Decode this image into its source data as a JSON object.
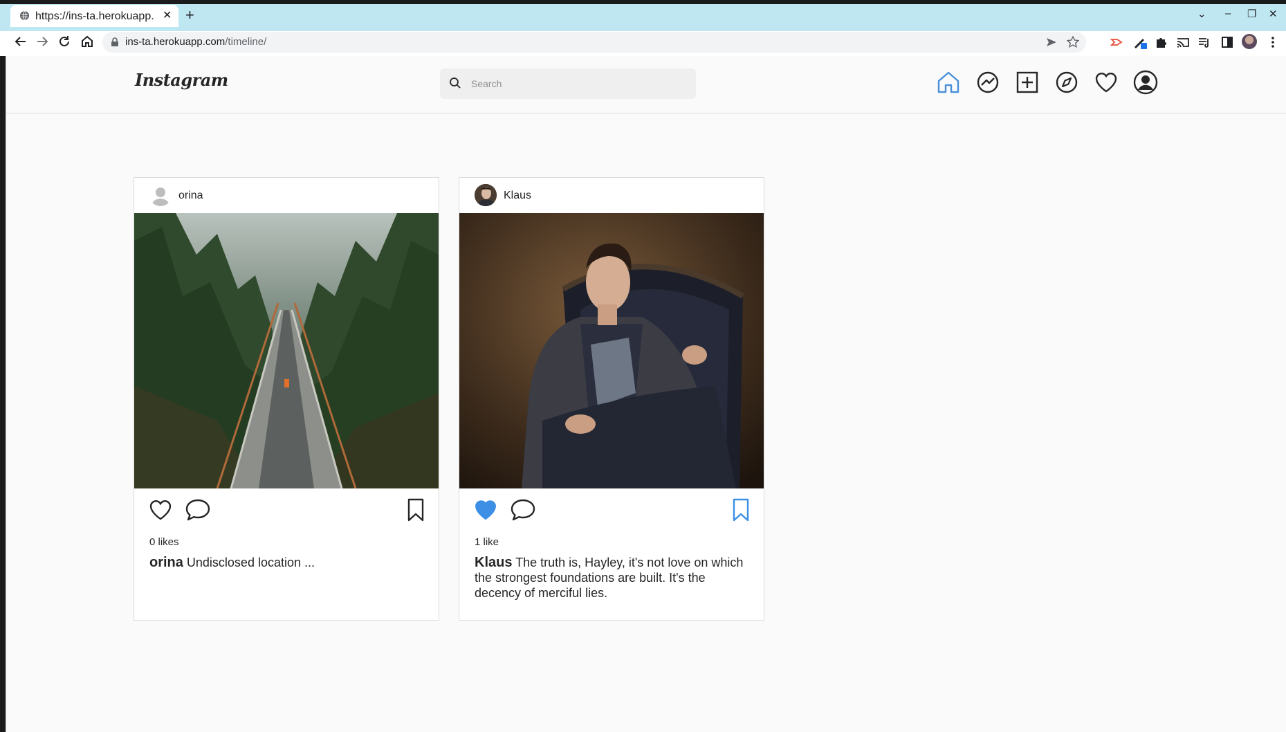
{
  "browser": {
    "tab_title": "https://ins-ta.herokuapp.",
    "url_domain": "ins-ta.herokuapp.com",
    "url_path": "/timeline/",
    "new_tab_label": "+",
    "tab_close_label": "✕",
    "window_controls": [
      "⌄",
      "–",
      "❐",
      "✕"
    ]
  },
  "header": {
    "logo": "Instagram",
    "search_placeholder": "Search",
    "nav_icons": [
      "home-icon",
      "messenger-icon",
      "new-post-icon",
      "explore-icon",
      "activity-heart-icon",
      "profile-icon"
    ],
    "active_color": "#4a90d9"
  },
  "posts": [
    {
      "username": "orina",
      "likes": "0 likes",
      "caption_user": "orina",
      "caption_text": " Undisclosed location ...",
      "liked": false,
      "saved": false
    },
    {
      "username": "Klaus",
      "likes": "1 like",
      "caption_user": "Klaus",
      "caption_text": " The truth is, Hayley, it's not love on which the strongest foundations are built. It's the decency of merciful lies.",
      "liked": true,
      "saved": true
    }
  ],
  "colors": {
    "accent_blue": "#3d8fe6",
    "tab_bar": "#bfe7f2"
  }
}
